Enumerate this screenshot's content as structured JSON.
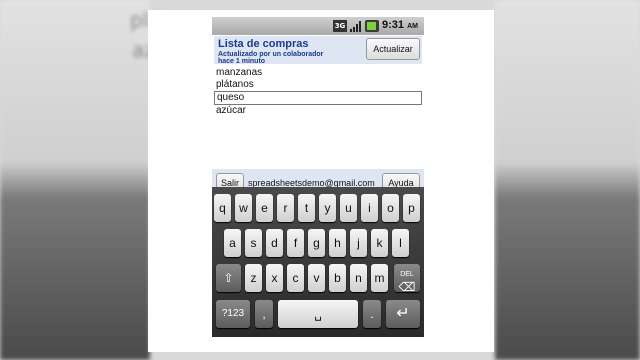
{
  "status_bar": {
    "network": "3G",
    "time": "9:31",
    "ampm": "AM"
  },
  "header": {
    "title": "Lista de compras",
    "subtitle": "Actualizado por un colaborador hace 1 minuto",
    "update_button": "Actualizar"
  },
  "list": [
    "manzanas",
    "plátanos",
    "queso",
    "azúcar"
  ],
  "footer": {
    "exit_button": "Salir",
    "email": "spreadsheetsdemo@gmail.com",
    "help_button": "Ayuda"
  },
  "keyboard": {
    "row1": [
      "q",
      "w",
      "e",
      "r",
      "t",
      "y",
      "u",
      "i",
      "o",
      "p"
    ],
    "row2": [
      "a",
      "s",
      "d",
      "f",
      "g",
      "h",
      "j",
      "k",
      "l"
    ],
    "row3": [
      "z",
      "x",
      "c",
      "v",
      "b",
      "n",
      "m"
    ],
    "del": "DEL",
    "sym": "?123",
    "comma": ",",
    "period": "."
  },
  "background": {
    "blur_line1": "plátanos",
    "blur_line2": "az"
  }
}
